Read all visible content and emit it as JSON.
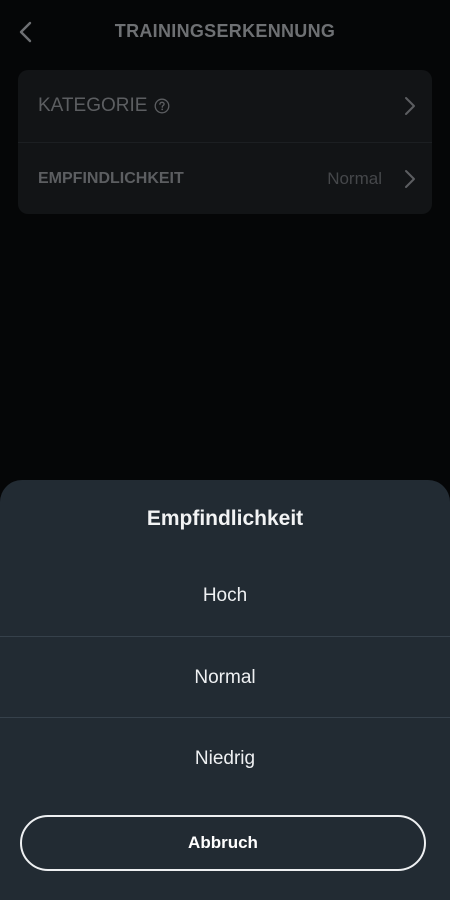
{
  "header": {
    "title": "TRAININGSERKENNUNG",
    "back_icon": "chevron-left-icon"
  },
  "settings": {
    "category": {
      "label": "KATEGORIE",
      "help_icon": "question-circle-icon"
    },
    "sensitivity": {
      "label": "EMPFINDLICHKEIT",
      "value": "Normal"
    }
  },
  "sheet": {
    "title": "Empfindlichkeit",
    "options": [
      {
        "label": "Hoch"
      },
      {
        "label": "Normal"
      },
      {
        "label": "Niedrig"
      }
    ],
    "cancel_label": "Abbruch"
  },
  "colors": {
    "background": "#050607",
    "card": "#121416",
    "sheet": "#222b33",
    "text_primary": "#eef0f2",
    "text_muted": "#5c5e61"
  }
}
